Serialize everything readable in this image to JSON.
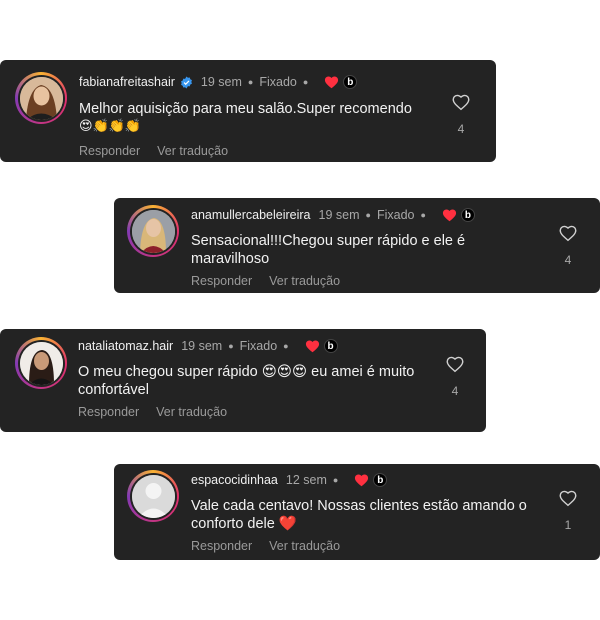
{
  "comments": [
    {
      "username": "fabianafreitashair",
      "verified": true,
      "time": "19 sem",
      "pinned": "Fixado",
      "text_line1": "Melhor aquisição para meu salão.Super recomendo",
      "text_line2": "😍👏👏👏",
      "reply": "Responder",
      "translate": "Ver tradução",
      "likes": "4",
      "avatar": "woman-long-hair-avatar"
    },
    {
      "username": "anamullercabeleireira",
      "verified": false,
      "time": "19 sem",
      "pinned": "Fixado",
      "text_line1": "Sensacional!!!Chegou super rápido e ele é",
      "text_line2": "maravilhoso",
      "reply": "Responder",
      "translate": "Ver tradução",
      "likes": "4",
      "avatar": "blonde-woman-avatar"
    },
    {
      "username": "nataliatomaz.hair",
      "verified": false,
      "time": "19 sem",
      "pinned": "Fixado",
      "text_line1": "O meu chegou super rápido 😍😍😍 eu amei é muito",
      "text_line2": "confortável",
      "reply": "Responder",
      "translate": "Ver tradução",
      "likes": "4",
      "avatar": "dark-hair-woman-avatar"
    },
    {
      "username": "espacocidinhaa",
      "verified": false,
      "time": "12 sem",
      "pinned": "",
      "text_line1": "Vale cada centavo! Nossas clientes estão amando o",
      "text_line2": "conforto dele ❤️",
      "reply": "Responder",
      "translate": "Ver tradução",
      "likes": "1",
      "avatar": "default-profile-avatar"
    }
  ],
  "author_badge": "b",
  "colors": {
    "card_bg": "#232323",
    "heart_red": "#ff3040",
    "verified_blue": "#3897f0",
    "muted_text": "#a8a8a8"
  }
}
